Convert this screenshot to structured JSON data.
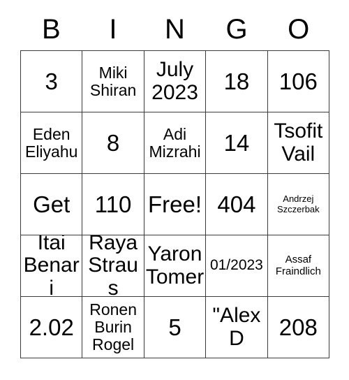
{
  "card": {
    "headers": [
      "B",
      "I",
      "N",
      "G",
      "O"
    ],
    "rows": [
      [
        {
          "text": "3",
          "size": "sz-xl"
        },
        {
          "text": "Miki\nShiran",
          "size": "sz-md"
        },
        {
          "text": "July\n2023",
          "size": "sz-lg"
        },
        {
          "text": "18",
          "size": "sz-xl"
        },
        {
          "text": "106",
          "size": "sz-xl"
        }
      ],
      [
        {
          "text": "Eden\nEliyahu",
          "size": "sz-md"
        },
        {
          "text": "8",
          "size": "sz-xl"
        },
        {
          "text": "Adi\nMizrahi",
          "size": "sz-md"
        },
        {
          "text": "14",
          "size": "sz-xl"
        },
        {
          "text": "Tsofit\nVail",
          "size": "sz-lg"
        }
      ],
      [
        {
          "text": "Get",
          "size": "sz-xl"
        },
        {
          "text": "110",
          "size": "sz-xl"
        },
        {
          "text": "Free!",
          "size": "sz-xl"
        },
        {
          "text": "404",
          "size": "sz-xl"
        },
        {
          "text": "Andrzej\nSzczerbak",
          "size": "sz-xxs"
        }
      ],
      [
        {
          "text": "Itai\nBenari",
          "size": "sz-lg"
        },
        {
          "text": "Raya\nStraus",
          "size": "sz-lg"
        },
        {
          "text": "Yaron\nTomer",
          "size": "sz-lg"
        },
        {
          "text": "01/2023",
          "size": "sz-sm"
        },
        {
          "text": "Assaf\nFraindlich",
          "size": "sz-xs"
        }
      ],
      [
        {
          "text": "2.02",
          "size": "sz-xl"
        },
        {
          "text": "Ronen\nBurin\nRogel",
          "size": "sz-md"
        },
        {
          "text": "5",
          "size": "sz-xl"
        },
        {
          "text": "\"Alex\nD",
          "size": "sz-lg"
        },
        {
          "text": "208",
          "size": "sz-xl"
        }
      ]
    ]
  }
}
